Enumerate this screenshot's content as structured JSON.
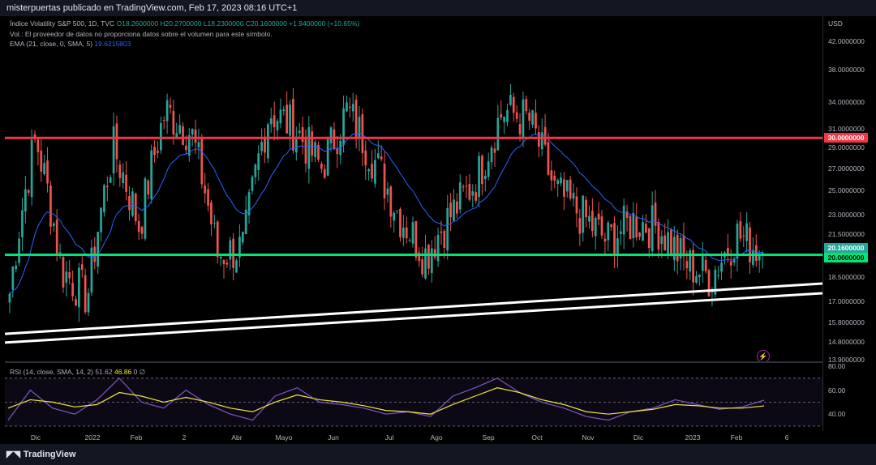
{
  "header": {
    "publisher": "misterpuertas publicado en TradingView.com, Feb 17, 2023 08:16 UTC+1"
  },
  "legend": {
    "symbol": "Índice Volatility S&P 500, 1D, TVC",
    "ohlc": "O18.2600000 H20.2700000 L18.2300000 C20.1600000 +1.9400000 (+10.65%)",
    "volume_note": "Vol.: El proveedor de datos no proporciona datos sobre el volumen para este símbolo.",
    "ema_label": "EMA (21, close, 0, SMA, 5)",
    "ema_value": "19.6215803",
    "rsi_label": "RSI (14, close, SMA, 14, 2)",
    "rsi_value": "51.62",
    "rsi_ma_value": "46.86",
    "rsi_extra": "0  ∅"
  },
  "footer": {
    "brand": "TradingView",
    "brand_icon": "tradingview-logo-icon"
  },
  "colors": {
    "up": "#26a69a",
    "down": "#ef5350",
    "ema": "#2962ff",
    "resistance": "#f23645",
    "support": "#00e676",
    "trendline": "#ffffff",
    "rsi": "#7e57c2",
    "rsi_ma": "#f0e442"
  },
  "chart_data": [
    {
      "type": "candlestick",
      "currency": "USD",
      "ylim": [
        13.9,
        44.0
      ],
      "y_scale": "log",
      "y_ticks": [
        "42.0000000",
        "38.0000000",
        "34.0000000",
        "31.0000000",
        "29.0000000",
        "27.0000000",
        "25.0000000",
        "23.0000000",
        "21.5000000",
        "20.0000000",
        "18.5000000",
        "17.0000000",
        "15.8000000",
        "14.8000000",
        "13.9000000"
      ],
      "x_ticks": [
        "Dic",
        "2022",
        "Feb",
        "2",
        "Abr",
        "Mayo",
        "Jun",
        "Jul",
        "Ago",
        "Sep",
        "Oct",
        "Nov",
        "Dic",
        "2023",
        "Feb",
        "6"
      ],
      "price_profile": [
        [
          "Dic",
          17.5
        ],
        [
          "Dic",
          30.0
        ],
        [
          "2022",
          19.0
        ],
        [
          "2022",
          17.3
        ],
        [
          "Feb",
          29.0
        ],
        [
          "Feb",
          22.0
        ],
        [
          "2",
          33.0
        ],
        [
          "2",
          30.5
        ],
        [
          "Abr",
          20.0
        ],
        [
          "Abr",
          20.5
        ],
        [
          "Mayo",
          33.0
        ],
        [
          "Mayo",
          31.0
        ],
        [
          "Jun",
          27.0
        ],
        [
          "Jun",
          33.0
        ],
        [
          "Jul",
          28.0
        ],
        [
          "Ago",
          23.0
        ],
        [
          "Ago",
          20.0
        ],
        [
          "Sep",
          23.0
        ],
        [
          "Sep",
          26.0
        ],
        [
          "Oct",
          33.0
        ],
        [
          "Oct",
          32.0
        ],
        [
          "Nov",
          25.0
        ],
        [
          "Nov",
          23.0
        ],
        [
          "Dic",
          21.0
        ],
        [
          "Dic",
          22.5
        ],
        [
          "2023",
          22.0
        ],
        [
          "2023",
          19.5
        ],
        [
          "Feb",
          18.5
        ],
        [
          "Feb",
          21.5
        ],
        [
          "Feb",
          20.16
        ]
      ],
      "horizontal_lines": [
        {
          "value": 30.0,
          "label": "30.0000000",
          "color": "#f23645"
        },
        {
          "value": 20.0,
          "label": "20.0000000",
          "color": "#00e676"
        }
      ],
      "last_price": {
        "value": 20.16,
        "label": "20.1600000"
      },
      "trendlines": [
        {
          "from": [
            "Dic",
            15.2
          ],
          "to": [
            "6",
            18.1
          ]
        },
        {
          "from": [
            "Dic",
            14.75
          ],
          "to": [
            "6",
            17.5
          ]
        }
      ]
    },
    {
      "type": "line",
      "title": "RSI",
      "ylim": [
        30,
        80
      ],
      "y_ticks": [
        "80.00",
        "60.00",
        "40.00"
      ],
      "bands": [
        70,
        50,
        30
      ],
      "series": [
        {
          "name": "RSI",
          "values": [
            35,
            60,
            45,
            40,
            52,
            70,
            50,
            45,
            60,
            48,
            40,
            35,
            55,
            62,
            50,
            48,
            45,
            40,
            42,
            38,
            55,
            62,
            70,
            58,
            50,
            45,
            38,
            35,
            42,
            45,
            52,
            48,
            44,
            46,
            51.62
          ]
        },
        {
          "name": "RSI MA",
          "values": [
            45,
            52,
            50,
            46,
            48,
            58,
            55,
            50,
            54,
            50,
            45,
            42,
            50,
            56,
            52,
            50,
            47,
            43,
            42,
            40,
            48,
            55,
            62,
            58,
            52,
            48,
            42,
            40,
            42,
            44,
            48,
            47,
            45,
            45,
            46.86
          ]
        }
      ]
    }
  ]
}
